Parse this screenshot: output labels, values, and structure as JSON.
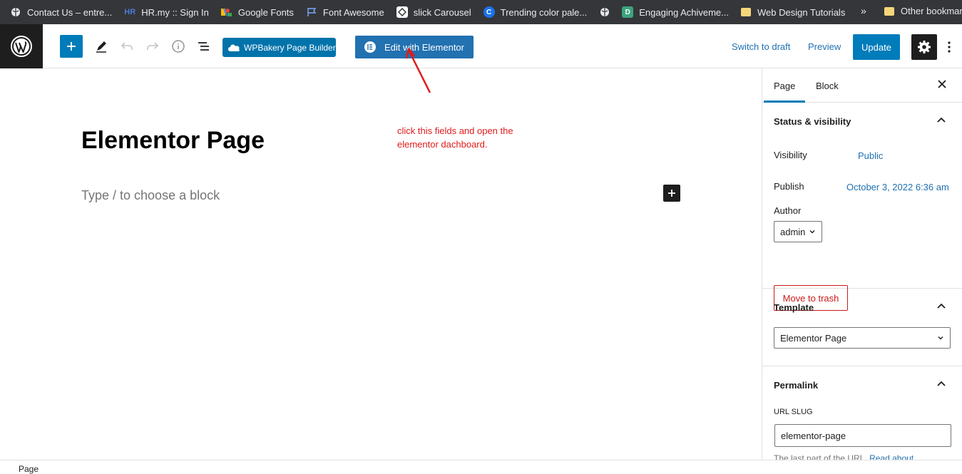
{
  "bookmarks": {
    "items": [
      {
        "label": "Contact Us – entre...",
        "icon": "globe-icon"
      },
      {
        "label": "HR.my :: Sign In",
        "icon": "hr-icon"
      },
      {
        "label": "Google Fonts",
        "icon": "google-fonts-icon"
      },
      {
        "label": "Font Awesome",
        "icon": "flag-icon"
      },
      {
        "label": "slick Carousel",
        "icon": "slick-icon"
      },
      {
        "label": "Trending color pale...",
        "icon": "c-icon"
      },
      {
        "label": "",
        "icon": "globe-icon"
      },
      {
        "label": "Engaging Achiveme...",
        "icon": "d-icon"
      },
      {
        "label": "Web Design Tutorials",
        "icon": "folder-icon"
      }
    ],
    "more": "»",
    "other": "Other bookmarks"
  },
  "toolbar": {
    "wpbakery_label": "WPBakery Page Builder",
    "elementor_label": "Edit with Elementor",
    "switch_draft": "Switch to draft",
    "preview": "Preview",
    "update": "Update"
  },
  "editor": {
    "title": "Elementor Page",
    "placeholder": "Type / to choose a block",
    "annotation": "click this fields and open the elementor dachboard."
  },
  "sidebar": {
    "tabs": [
      "Page",
      "Block"
    ],
    "status": {
      "title": "Status & visibility",
      "visibility_label": "Visibility",
      "visibility_value": "Public",
      "publish_label": "Publish",
      "publish_value": "October 3, 2022 6:36 am",
      "author_label": "Author",
      "author_value": "admin",
      "trash": "Move to trash"
    },
    "template": {
      "title": "Template",
      "value": "Elementor Page"
    },
    "permalink": {
      "title": "Permalink",
      "slug_label": "URL Slug",
      "slug_value": "elementor-page",
      "help": "The last part of the URL.",
      "help_link": "Read about"
    }
  },
  "footer": {
    "breadcrumb": "Page"
  },
  "colors": {
    "accent": "#007cba",
    "elementor_btn": "#2271b1",
    "danger": "#cc1818",
    "annotation": "#e01b1b"
  }
}
